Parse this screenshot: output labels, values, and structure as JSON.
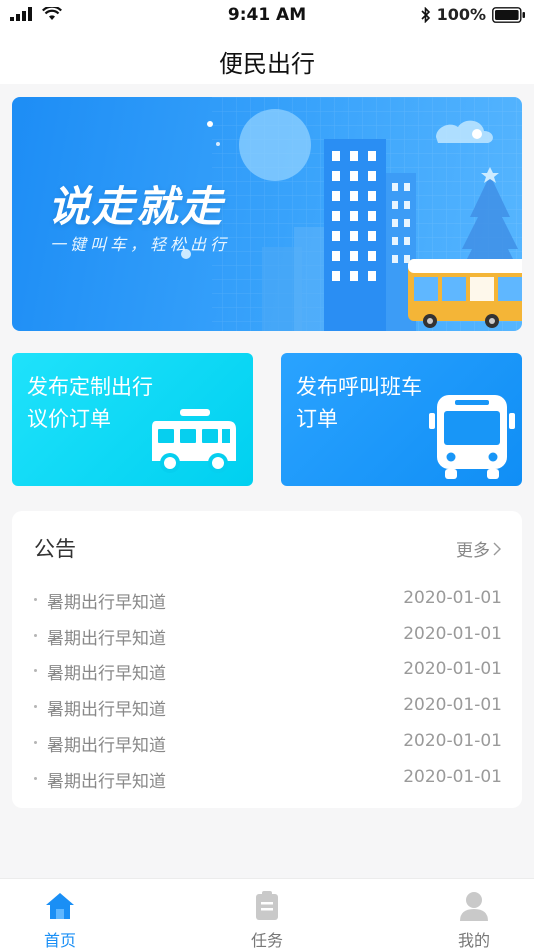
{
  "status_bar": {
    "time": "9:41 AM",
    "battery": "100%"
  },
  "nav": {
    "title": "便民出行"
  },
  "banner": {
    "slogan": "说走就走",
    "subtitle": "一键叫车，轻松出行"
  },
  "cards": [
    {
      "label_line1": "发布定制出行",
      "label_line2": "议价订单",
      "icon": "van-icon"
    },
    {
      "label_line1": "发布呼叫班车",
      "label_line2": "订单",
      "icon": "bus-icon"
    }
  ],
  "notice": {
    "title": "公告",
    "more": "更多",
    "items": [
      {
        "text": "暑期出行早知道",
        "date": "2020-01-01"
      },
      {
        "text": "暑期出行早知道",
        "date": "2020-01-01"
      },
      {
        "text": "暑期出行早知道",
        "date": "2020-01-01"
      },
      {
        "text": "暑期出行早知道",
        "date": "2020-01-01"
      },
      {
        "text": "暑期出行早知道",
        "date": "2020-01-01"
      },
      {
        "text": "暑期出行早知道",
        "date": "2020-01-01"
      }
    ]
  },
  "tabs": [
    {
      "label": "首页",
      "icon": "home-icon",
      "active": true
    },
    {
      "label": "任务",
      "icon": "clipboard-icon",
      "active": false
    },
    {
      "label": "我的",
      "icon": "user-icon",
      "active": false
    }
  ],
  "colors": {
    "accent": "#1a8ff5",
    "card_left": "#00d0f0",
    "card_right": "#108ef5"
  }
}
